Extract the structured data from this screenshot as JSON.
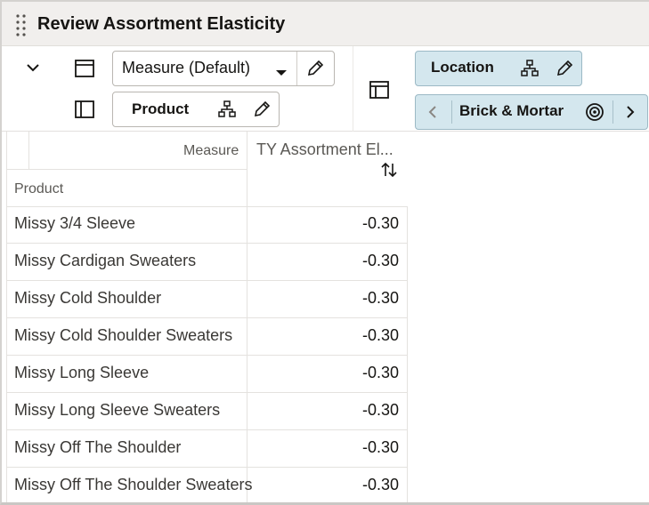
{
  "window": {
    "title": "Review Assortment Elasticity"
  },
  "toolbar": {
    "measure_selector": {
      "label": "Measure (Default)"
    },
    "product_selector": {
      "label": "Product"
    },
    "location_selector": {
      "label": "Location"
    },
    "location_member": {
      "label": "Brick & Mortar"
    }
  },
  "grid": {
    "corner_measure_label": "Measure",
    "corner_product_label": "Product",
    "column_header": "TY Assortment El...",
    "rows": [
      {
        "product": "Missy 3/4 Sleeve",
        "value": "-0.30"
      },
      {
        "product": "Missy Cardigan Sweaters",
        "value": "-0.30"
      },
      {
        "product": "Missy Cold Shoulder",
        "value": "-0.30"
      },
      {
        "product": "Missy Cold Shoulder Sweaters",
        "value": "-0.30"
      },
      {
        "product": "Missy Long Sleeve",
        "value": "-0.30"
      },
      {
        "product": "Missy Long Sleeve Sweaters",
        "value": "-0.30"
      },
      {
        "product": "Missy Off The Shoulder",
        "value": "-0.30"
      },
      {
        "product": "Missy Off The Shoulder Sweaters",
        "value": "-0.30"
      }
    ]
  },
  "colors": {
    "titlebar_bg": "#f1efed",
    "accent_pill_bg": "#d4e7ee",
    "text_primary": "#161513"
  }
}
